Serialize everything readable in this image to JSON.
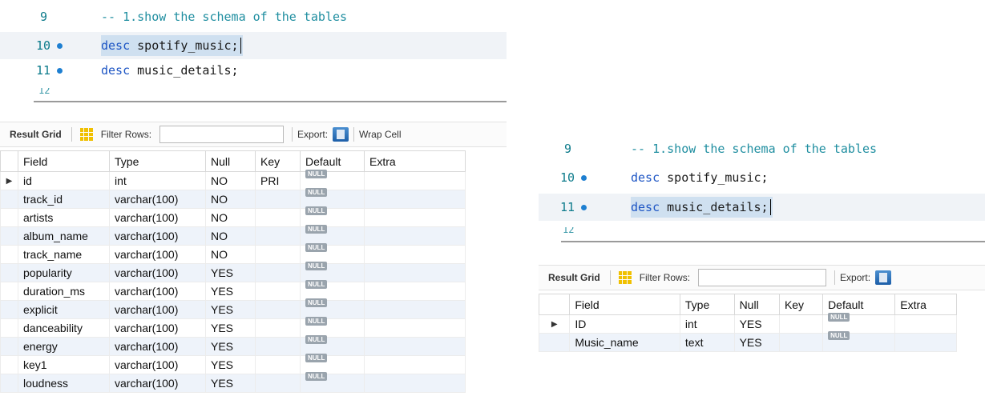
{
  "left": {
    "editor": {
      "lines": [
        {
          "num": "9",
          "marker": false,
          "keyword": "",
          "comment": "-- 1.show the schema of the tables",
          "rest": ""
        },
        {
          "num": "10",
          "marker": true,
          "keyword": "desc",
          "comment": "",
          "rest": " spotify_music;"
        },
        {
          "num": "11",
          "marker": true,
          "keyword": "desc",
          "comment": "",
          "rest": " music_details;"
        }
      ],
      "peek_num": "12"
    },
    "toolbar": {
      "result_grid_label": "Result Grid",
      "filter_label": "Filter Rows:",
      "filter_value": "",
      "export_label": "Export:",
      "wrap_label": "Wrap Cell"
    },
    "grid": {
      "columns": [
        "Field",
        "Type",
        "Null",
        "Key",
        "Default",
        "Extra"
      ],
      "null_text": "NULL",
      "rows": [
        {
          "field": "id",
          "type": "int",
          "null": "NO",
          "key": "PRI",
          "selected": true
        },
        {
          "field": "track_id",
          "type": "varchar(100)",
          "null": "NO",
          "key": ""
        },
        {
          "field": "artists",
          "type": "varchar(100)",
          "null": "NO",
          "key": ""
        },
        {
          "field": "album_name",
          "type": "varchar(100)",
          "null": "NO",
          "key": ""
        },
        {
          "field": "track_name",
          "type": "varchar(100)",
          "null": "NO",
          "key": ""
        },
        {
          "field": "popularity",
          "type": "varchar(100)",
          "null": "YES",
          "key": ""
        },
        {
          "field": "duration_ms",
          "type": "varchar(100)",
          "null": "YES",
          "key": ""
        },
        {
          "field": "explicit",
          "type": "varchar(100)",
          "null": "YES",
          "key": ""
        },
        {
          "field": "danceability",
          "type": "varchar(100)",
          "null": "YES",
          "key": ""
        },
        {
          "field": "energy",
          "type": "varchar(100)",
          "null": "YES",
          "key": ""
        },
        {
          "field": "key1",
          "type": "varchar(100)",
          "null": "YES",
          "key": ""
        },
        {
          "field": "loudness",
          "type": "varchar(100)",
          "null": "YES",
          "key": ""
        }
      ]
    }
  },
  "right": {
    "editor": {
      "lines": [
        {
          "num": "9",
          "marker": false,
          "keyword": "",
          "comment": "-- 1.show the schema of the tables",
          "rest": ""
        },
        {
          "num": "10",
          "marker": true,
          "keyword": "desc",
          "comment": "",
          "rest": " spotify_music;"
        },
        {
          "num": "11",
          "marker": true,
          "keyword": "desc",
          "comment": "",
          "rest": " music_details;"
        }
      ],
      "peek_num": "12"
    },
    "toolbar": {
      "result_grid_label": "Result Grid",
      "filter_label": "Filter Rows:",
      "filter_value": "",
      "export_label": "Export:"
    },
    "grid": {
      "columns": [
        "Field",
        "Type",
        "Null",
        "Key",
        "Default",
        "Extra"
      ],
      "null_text": "NULL",
      "rows": [
        {
          "field": "ID",
          "type": "int",
          "null": "YES",
          "key": "",
          "selected": true
        },
        {
          "field": "Music_name",
          "type": "text",
          "null": "YES",
          "key": ""
        }
      ]
    }
  },
  "colors": {
    "keyword": "#1d55c4",
    "comment": "#1f8ea0",
    "selection": "#cfe0f0",
    "row_alt": "#eef3fa",
    "null_badge": "#9aa4ad"
  }
}
